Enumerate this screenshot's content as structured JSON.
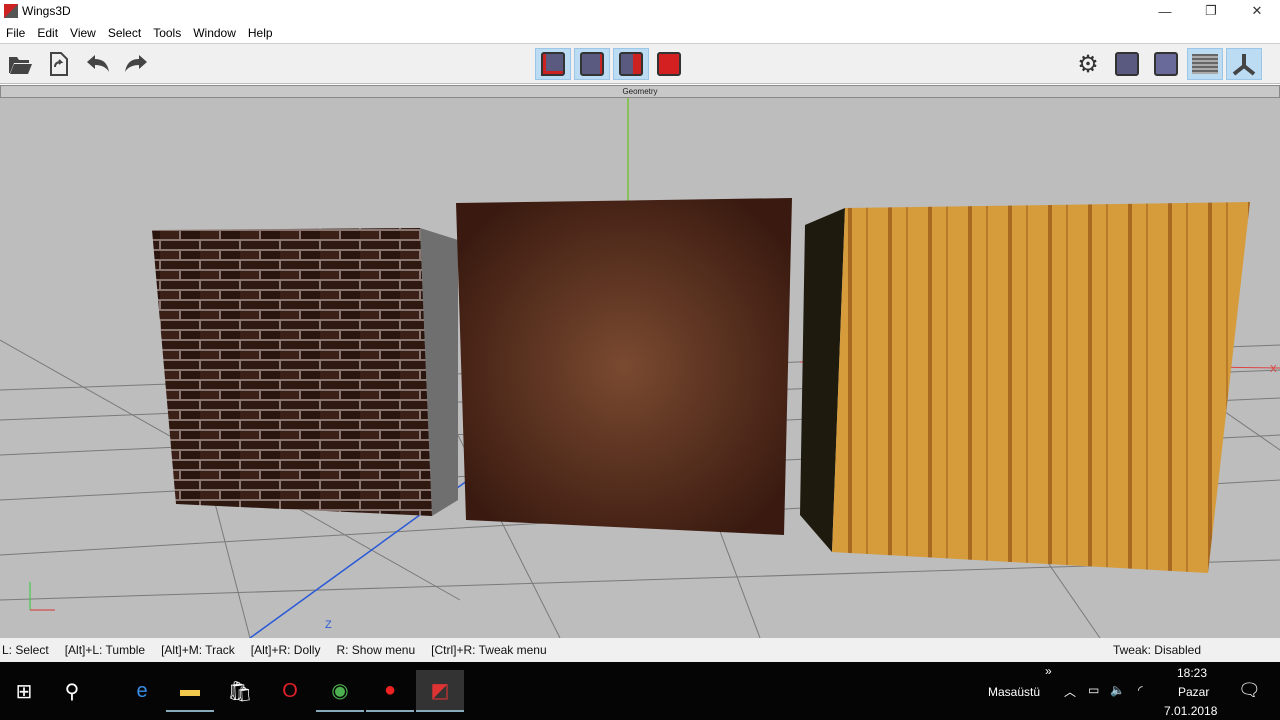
{
  "window": {
    "title": "Wings3D",
    "minimize": "—",
    "restore": "❐",
    "close": "✕"
  },
  "menu": [
    "File",
    "Edit",
    "View",
    "Select",
    "Tools",
    "Window",
    "Help"
  ],
  "toolbar": {
    "left": [
      "open-icon",
      "save-icon",
      "undo-icon",
      "redo-icon"
    ],
    "select_modes": [
      "vertex-select",
      "edge-select",
      "face-select",
      "body-select"
    ],
    "right": [
      "settings-icon",
      "smooth-shading-icon",
      "flat-shading-icon",
      "ground-plane-icon",
      "axes-icon"
    ]
  },
  "viewport": {
    "header": "Geometry",
    "axis_label_z": "Z",
    "axis_label_x": "X"
  },
  "status": {
    "items": [
      "L: Select",
      "[Alt]+L: Tumble",
      "[Alt]+M: Track",
      "[Alt]+R: Dolly",
      "R: Show menu",
      "[Ctrl]+R: Tweak menu"
    ],
    "tweak": "Tweak: Disabled"
  },
  "taskbar": {
    "apps": [
      "start",
      "search",
      "edge",
      "file-explorer",
      "store",
      "opera",
      "chrome",
      "recorder",
      "wings3d"
    ],
    "desktop": "Masaüstü",
    "chevron": "»",
    "time": "18:23",
    "day": "Pazar",
    "date": "7.01.2018"
  },
  "colors": {
    "brick": "#3a1f16",
    "wood": "#d49a3a",
    "rock": "#5a3320",
    "select_bg": "#bcdcf4"
  }
}
